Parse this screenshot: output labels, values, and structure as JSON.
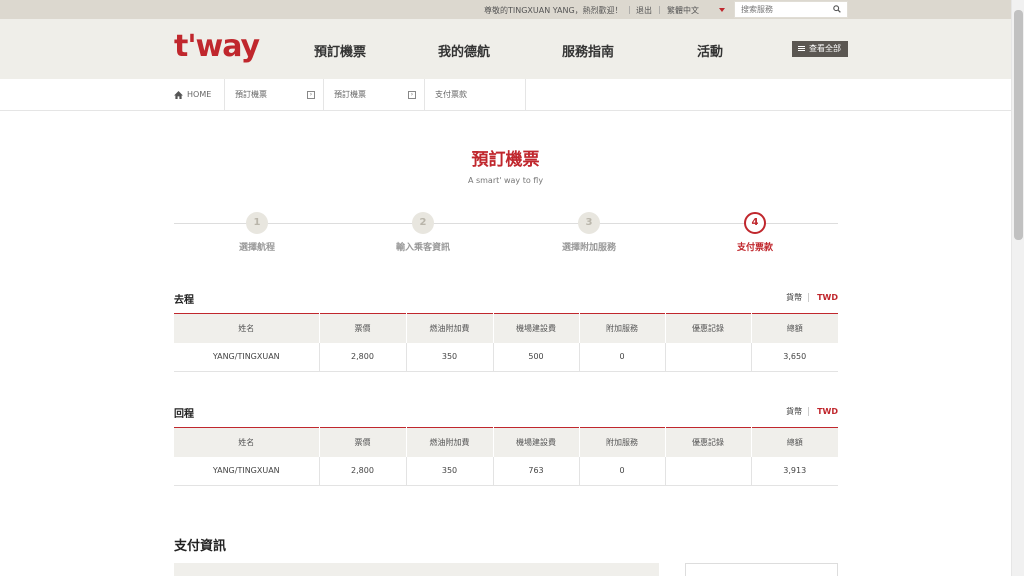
{
  "topbar": {
    "greeting": "尊敬的TINGXUAN YANG，熱烈歡迎！",
    "logout": "退出",
    "language": "繁體中文",
    "search_placeholder": "搜索服務"
  },
  "header": {
    "logo": "t'way",
    "nav": [
      "預訂機票",
      "我的德航",
      "服務指南",
      "活動"
    ],
    "view_all": "查看全部"
  },
  "breadcrumb": [
    "HOME",
    "預訂機票",
    "預訂機票",
    "支付票款"
  ],
  "page": {
    "title": "預訂機票",
    "subtitle": "A smart' way to fly"
  },
  "steps": [
    {
      "num": "1",
      "label": "選擇航程"
    },
    {
      "num": "2",
      "label": "輸入乘客資訊"
    },
    {
      "num": "3",
      "label": "選擇附加服務"
    },
    {
      "num": "4",
      "label": "支付票款"
    }
  ],
  "currency_label": "貨幣",
  "currency": "TWD",
  "table_headers": [
    "姓名",
    "票價",
    "燃油附加費",
    "機場建設費",
    "附加服務",
    "優惠記錄",
    "總額"
  ],
  "outbound": {
    "title": "去程",
    "rows": [
      [
        "YANG/TINGXUAN",
        "2,800",
        "350",
        "500",
        "0",
        "",
        "3,650"
      ]
    ]
  },
  "return": {
    "title": "回程",
    "rows": [
      [
        "YANG/TINGXUAN",
        "2,800",
        "350",
        "763",
        "0",
        "",
        "3,913"
      ]
    ]
  },
  "payment": {
    "title": "支付資訊"
  },
  "colors": {
    "accent": "#c0272d",
    "header_bg": "#efeee9",
    "topbar_bg": "#dcd8cf"
  }
}
